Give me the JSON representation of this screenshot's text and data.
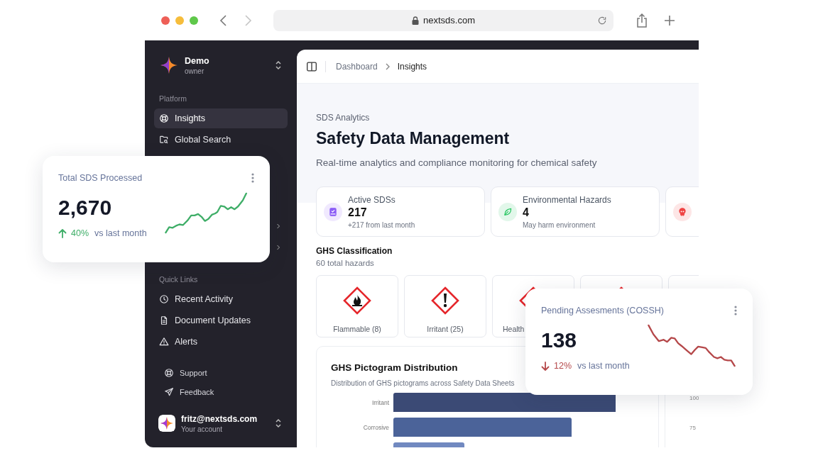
{
  "browser": {
    "url": "nextsds.com"
  },
  "sidebar": {
    "workspace": {
      "name": "Demo",
      "role": "owner"
    },
    "sections": [
      {
        "label": "Platform",
        "items": [
          {
            "label": "Insights",
            "selected": true
          },
          {
            "label": "Global Search",
            "selected": false
          },
          {
            "expanded": false
          },
          {
            "expanded": false
          }
        ]
      },
      {
        "label": "Quick Links",
        "items": [
          {
            "label": "Recent Activity",
            "selected": false
          },
          {
            "label": "Document Updates",
            "selected": false
          },
          {
            "label": "Alerts",
            "selected": false
          }
        ]
      }
    ],
    "footer_links": [
      {
        "label": "Support"
      },
      {
        "label": "Feedback"
      }
    ],
    "account": {
      "email": "fritz@nextsds.com",
      "caption": "Your account"
    }
  },
  "breadcrumb": [
    {
      "label": "Dashboard",
      "selected": false
    },
    {
      "label": "Insights",
      "selected": true
    }
  ],
  "hero": {
    "eyebrow": "SDS Analytics",
    "title": "Safety Data Management",
    "subtitle": "Real-time analytics and compliance monitoring for chemical safety"
  },
  "stats": [
    {
      "title": "Active SDSs",
      "value": "217",
      "note": "+217 from last month",
      "color": "#8b5cf6"
    },
    {
      "title": "Environmental Hazards",
      "value": "4",
      "note": "May harm environment",
      "color": "#22c55e"
    },
    {
      "color": "#ef4444"
    }
  ],
  "ghs": {
    "title": "GHS Classification",
    "subtitle": "60 total hazards",
    "tiles": [
      {
        "label": "Flammable (8)"
      },
      {
        "label": "Irritant (25)"
      },
      {
        "label": "Health"
      }
    ]
  },
  "distribution": {
    "title": "GHS Pictogram Distribution",
    "subtitle": "Distribution of GHS pictograms across Safety Data Sheets",
    "bar_labels": [
      "Irritant",
      "Corrosive"
    ]
  },
  "side_chart": {
    "axis_labels": [
      "100",
      "75"
    ]
  },
  "overlays": [
    {
      "title": "Total SDS Processed",
      "value": "2,670",
      "kind": "up",
      "change": "40%",
      "caption": "vs last month"
    },
    {
      "title": "Pending Assesments (COSSH)",
      "value": "138",
      "kind": "down",
      "change": "12%",
      "caption": "vs last month"
    }
  ]
}
